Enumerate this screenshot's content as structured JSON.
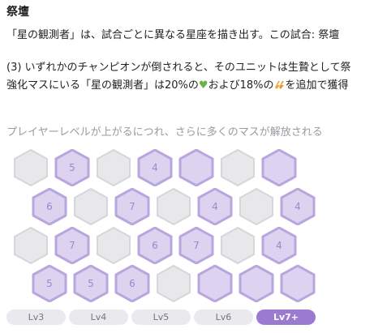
{
  "header": {
    "title": "祭壇"
  },
  "description": {
    "line1": "「星の観測者」は、試合ごとに異なる星座を描き出す。この試合: 祭壇",
    "line2": "(3) いずれかのチャンピオンが倒されると、そのユニットは生贄として祭",
    "line3_pre": "強化マスにいる「星の観測者」は20%の",
    "line3_mid": "および18%の",
    "line3_post": "を追加で獲得"
  },
  "unlock_note": "プレイヤーレベルが上がるにつれ、さらに多くのマスが解放される",
  "board": {
    "rows": [
      [
        {
          "label": "",
          "state": "locked"
        },
        {
          "label": "5",
          "state": "constellation"
        },
        {
          "label": "",
          "state": "locked"
        },
        {
          "label": "4",
          "state": "constellation"
        },
        {
          "label": "",
          "state": "constellation"
        },
        {
          "label": "",
          "state": "locked"
        },
        {
          "label": "",
          "state": "constellation"
        }
      ],
      [
        {
          "label": "6",
          "state": "constellation"
        },
        {
          "label": "",
          "state": "locked"
        },
        {
          "label": "7",
          "state": "constellation"
        },
        {
          "label": "",
          "state": "locked"
        },
        {
          "label": "4",
          "state": "constellation"
        },
        {
          "label": "",
          "state": "locked"
        },
        {
          "label": "4",
          "state": "constellation"
        }
      ],
      [
        {
          "label": "",
          "state": "locked"
        },
        {
          "label": "7",
          "state": "constellation"
        },
        {
          "label": "",
          "state": "locked"
        },
        {
          "label": "6",
          "state": "constellation"
        },
        {
          "label": "7",
          "state": "constellation"
        },
        {
          "label": "",
          "state": "locked"
        },
        {
          "label": "4",
          "state": "constellation"
        }
      ],
      [
        {
          "label": "5",
          "state": "constellation"
        },
        {
          "label": "5",
          "state": "constellation"
        },
        {
          "label": "6",
          "state": "constellation"
        },
        {
          "label": "",
          "state": "locked"
        },
        {
          "label": "",
          "state": "constellation"
        },
        {
          "label": "",
          "state": "constellation"
        },
        {
          "label": "",
          "state": "constellation"
        }
      ]
    ]
  },
  "levels": [
    {
      "label": "Lv3",
      "active": false
    },
    {
      "label": "Lv4",
      "active": false
    },
    {
      "label": "Lv5",
      "active": false
    },
    {
      "label": "Lv6",
      "active": false
    },
    {
      "label": "Lv7+",
      "active": true
    }
  ],
  "colors": {
    "constellation_fill": "#ddd3f0",
    "constellation_stroke": "#b8a6de",
    "locked_fill": "#e8e8eb",
    "locked_stroke": "#d6d6da",
    "active_level": "#9b7bd0",
    "heart": "#6ab04c",
    "bolt": "#f0a830"
  },
  "icons": {
    "heart": "green-heart-icon",
    "bolt": "attack-speed-icon"
  }
}
